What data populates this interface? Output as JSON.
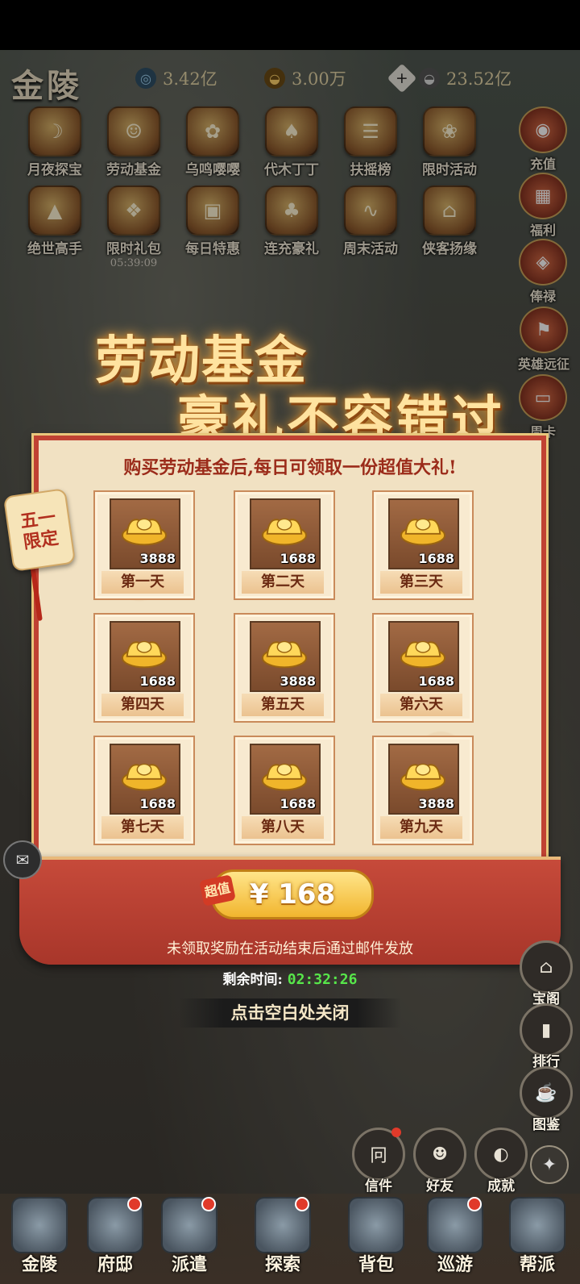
{
  "top_bar": {
    "city": "金陵",
    "resources": [
      {
        "icon": "swirl-icon",
        "value": "3.42亿",
        "color": "#7fb3d8"
      },
      {
        "icon": "gold-ingot-icon",
        "value": "3.00万",
        "color": "#e0b34a"
      },
      {
        "icon": "silver-ingot-icon",
        "value": "23.52亿",
        "color": "#cfd3d6"
      }
    ]
  },
  "activity_icons": [
    {
      "label": "月夜探宝",
      "icon": "treasure-scroll-icon"
    },
    {
      "label": "劳动基金",
      "icon": "fund-character-icon"
    },
    {
      "label": "乌鸣嘤嘤",
      "icon": "bird-icon"
    },
    {
      "label": "代木丁丁",
      "icon": "woodcutter-icon"
    },
    {
      "label": "扶摇榜",
      "icon": "ranking-scroll-icon"
    },
    {
      "label": "限时活动",
      "icon": "koi-plate-icon"
    },
    {
      "label": "绝世高手",
      "icon": "straw-hat-icon"
    },
    {
      "label": "限时礼包",
      "icon": "gift-bag-icon",
      "timer": "05:39:09"
    },
    {
      "label": "每日特惠",
      "icon": "chest-icon"
    },
    {
      "label": "连充豪礼",
      "icon": "golden-tree-icon"
    },
    {
      "label": "周末活动",
      "icon": "dragon-icon"
    },
    {
      "label": "侠客扬缘",
      "icon": "pavilion-icon"
    }
  ],
  "side_buttons": [
    {
      "label": "充值",
      "icon": "abacus-icon"
    },
    {
      "label": "福利",
      "icon": "bonus-box-icon"
    },
    {
      "label": "俸禄",
      "icon": "salary-seal-icon"
    },
    {
      "label": "英雄远征",
      "icon": "expedition-icon"
    },
    {
      "label": "周卡",
      "icon": "week-card-icon"
    }
  ],
  "promo": {
    "headline_1": "劳动基金",
    "headline_2": "豪礼不容错过",
    "subtitle": "购买劳动基金后,每日可领取一份超值大礼!",
    "tag_line1": "五一",
    "tag_line2": "限定",
    "rewards": [
      {
        "day": "第一天",
        "amount": "3888"
      },
      {
        "day": "第二天",
        "amount": "1688"
      },
      {
        "day": "第三天",
        "amount": "1688"
      },
      {
        "day": "第四天",
        "amount": "1688"
      },
      {
        "day": "第五天",
        "amount": "3888"
      },
      {
        "day": "第六天",
        "amount": "1688"
      },
      {
        "day": "第七天",
        "amount": "1688"
      },
      {
        "day": "第八天",
        "amount": "1688"
      },
      {
        "day": "第九天",
        "amount": "3888"
      }
    ],
    "badge": "超值",
    "price": "¥ 168",
    "notice": "未领取奖励在活动结束后通过邮件发放",
    "remaining_label": "剩余时间:",
    "remaining_time": "02:32:26",
    "close_hint": "点击空白处关闭"
  },
  "right_round_buttons": [
    {
      "label": "宝阁",
      "icon": "treasure-pavilion-icon"
    },
    {
      "label": "排行",
      "icon": "ranking-icon"
    },
    {
      "label": "图鉴",
      "icon": "codex-icon"
    }
  ],
  "bottom_round_buttons": [
    {
      "label": "信件",
      "icon": "letter-icon",
      "dot": true
    },
    {
      "label": "好友",
      "icon": "friends-icon",
      "dot": false
    },
    {
      "label": "成就",
      "icon": "achievement-icon",
      "dot": false
    }
  ],
  "bottom_nav": [
    {
      "label": "金陵",
      "icon": "city-gate-icon",
      "dot": false
    },
    {
      "label": "府邸",
      "icon": "mansion-icon",
      "dot": true
    },
    {
      "label": "派遣",
      "icon": "dispatch-icon",
      "dot": true
    },
    {
      "label": "探索",
      "icon": "explore-icon",
      "dot": true
    },
    {
      "label": "背包",
      "icon": "backpack-icon",
      "dot": false
    },
    {
      "label": "巡游",
      "icon": "tour-icon",
      "dot": true
    },
    {
      "label": "帮派",
      "icon": "guild-icon",
      "dot": false
    }
  ]
}
